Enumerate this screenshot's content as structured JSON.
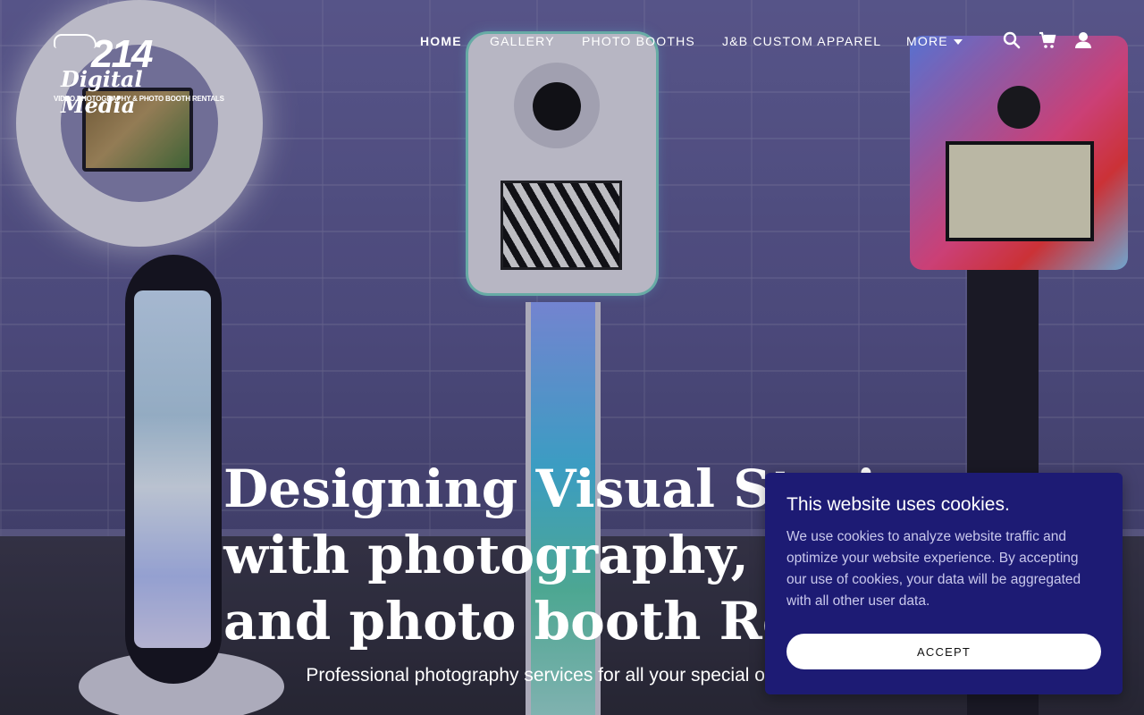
{
  "brand": {
    "logo_number": "214",
    "logo_script": "Digital Media",
    "logo_tagline": "VIDEO,PHOTOGRAPHY & PHOTO BOOTH RENTALS"
  },
  "nav": {
    "items": [
      {
        "label": "HOME",
        "active": true
      },
      {
        "label": "GALLERY"
      },
      {
        "label": "PHOTO BOOTHS"
      },
      {
        "label": "J&B CUSTOM APPAREL"
      },
      {
        "label": "MORE"
      }
    ],
    "icons": [
      "search-icon",
      "cart-icon",
      "account-icon"
    ]
  },
  "hero": {
    "headline_lines": [
      "Designing Visual Stories",
      "with photography, video",
      "and photo booth Rentals"
    ],
    "subline": "Professional photography services for all your special occasions"
  },
  "cookie_banner": {
    "title": "This website uses cookies.",
    "text": "We use cookies to analyze website traffic and optimize your website experience. By accepting our use of cookies, your data will be aggregated with all other user data.",
    "accept_label": "ACCEPT",
    "background": "#1d1b74"
  }
}
